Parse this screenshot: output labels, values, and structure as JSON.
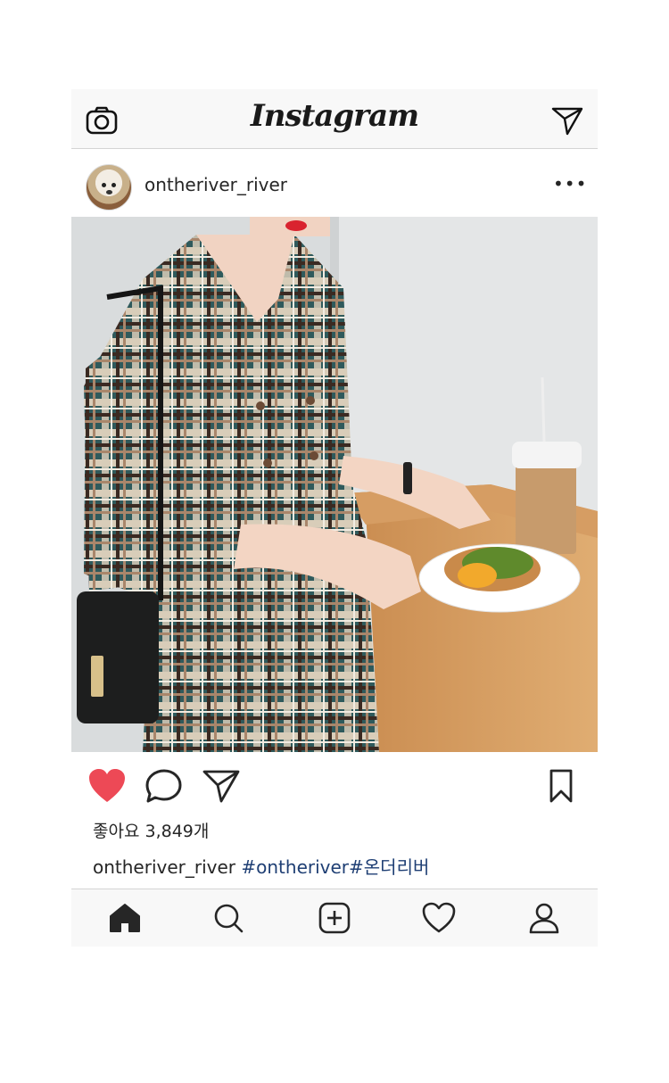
{
  "header": {
    "brand": "Instagram",
    "camera_icon": "camera-icon",
    "direct_icon": "paper-plane-icon"
  },
  "post": {
    "username": "ontheriver_river",
    "more_icon": "more-icon",
    "more_label": "•••",
    "photo_icon": "post-photo"
  },
  "actions": {
    "like_icon": "heart-filled-icon",
    "comment_icon": "comment-icon",
    "share_icon": "paper-plane-icon",
    "save_icon": "bookmark-icon"
  },
  "likes_text": "좋아요 3,849개",
  "caption": {
    "username": "ontheriver_river",
    "hashtags": "#ontheriver#온더리버"
  },
  "bottom_nav": [
    "home-icon",
    "search-icon",
    "add-post-icon",
    "activity-heart-icon",
    "profile-icon"
  ],
  "colors": {
    "like_red": "#ed4956",
    "hashtag_blue": "#1f3f74",
    "bar_bg": "#f8f8f8"
  }
}
